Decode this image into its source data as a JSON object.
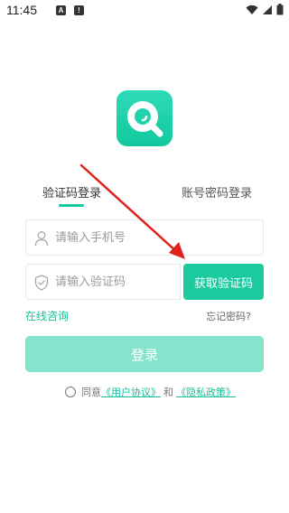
{
  "status_bar": {
    "time": "11:45",
    "notif_a": "A",
    "notif_b": "!"
  },
  "colors": {
    "brand": "#1ccaa0",
    "login_disabled": "#86e3cc",
    "arrow": "#e0201b"
  },
  "logo": {
    "icon": "magnifier-q-icon"
  },
  "tabs": [
    {
      "label": "验证码登录",
      "active": true
    },
    {
      "label": "账号密码登录",
      "active": false
    }
  ],
  "phone_field": {
    "placeholder": "请输入手机号",
    "icon": "user-icon"
  },
  "code_field": {
    "placeholder": "请输入验证码",
    "icon": "shield-check-icon"
  },
  "get_code_label": "获取验证码",
  "online_consult_label": "在线咨询",
  "forgot_password_label": "忘记密码?",
  "login_label": "登录",
  "agreement": {
    "prefix": "同意",
    "user_agreement": "《用户协议》",
    "and": "和",
    "privacy_policy": "《隐私政策》"
  }
}
